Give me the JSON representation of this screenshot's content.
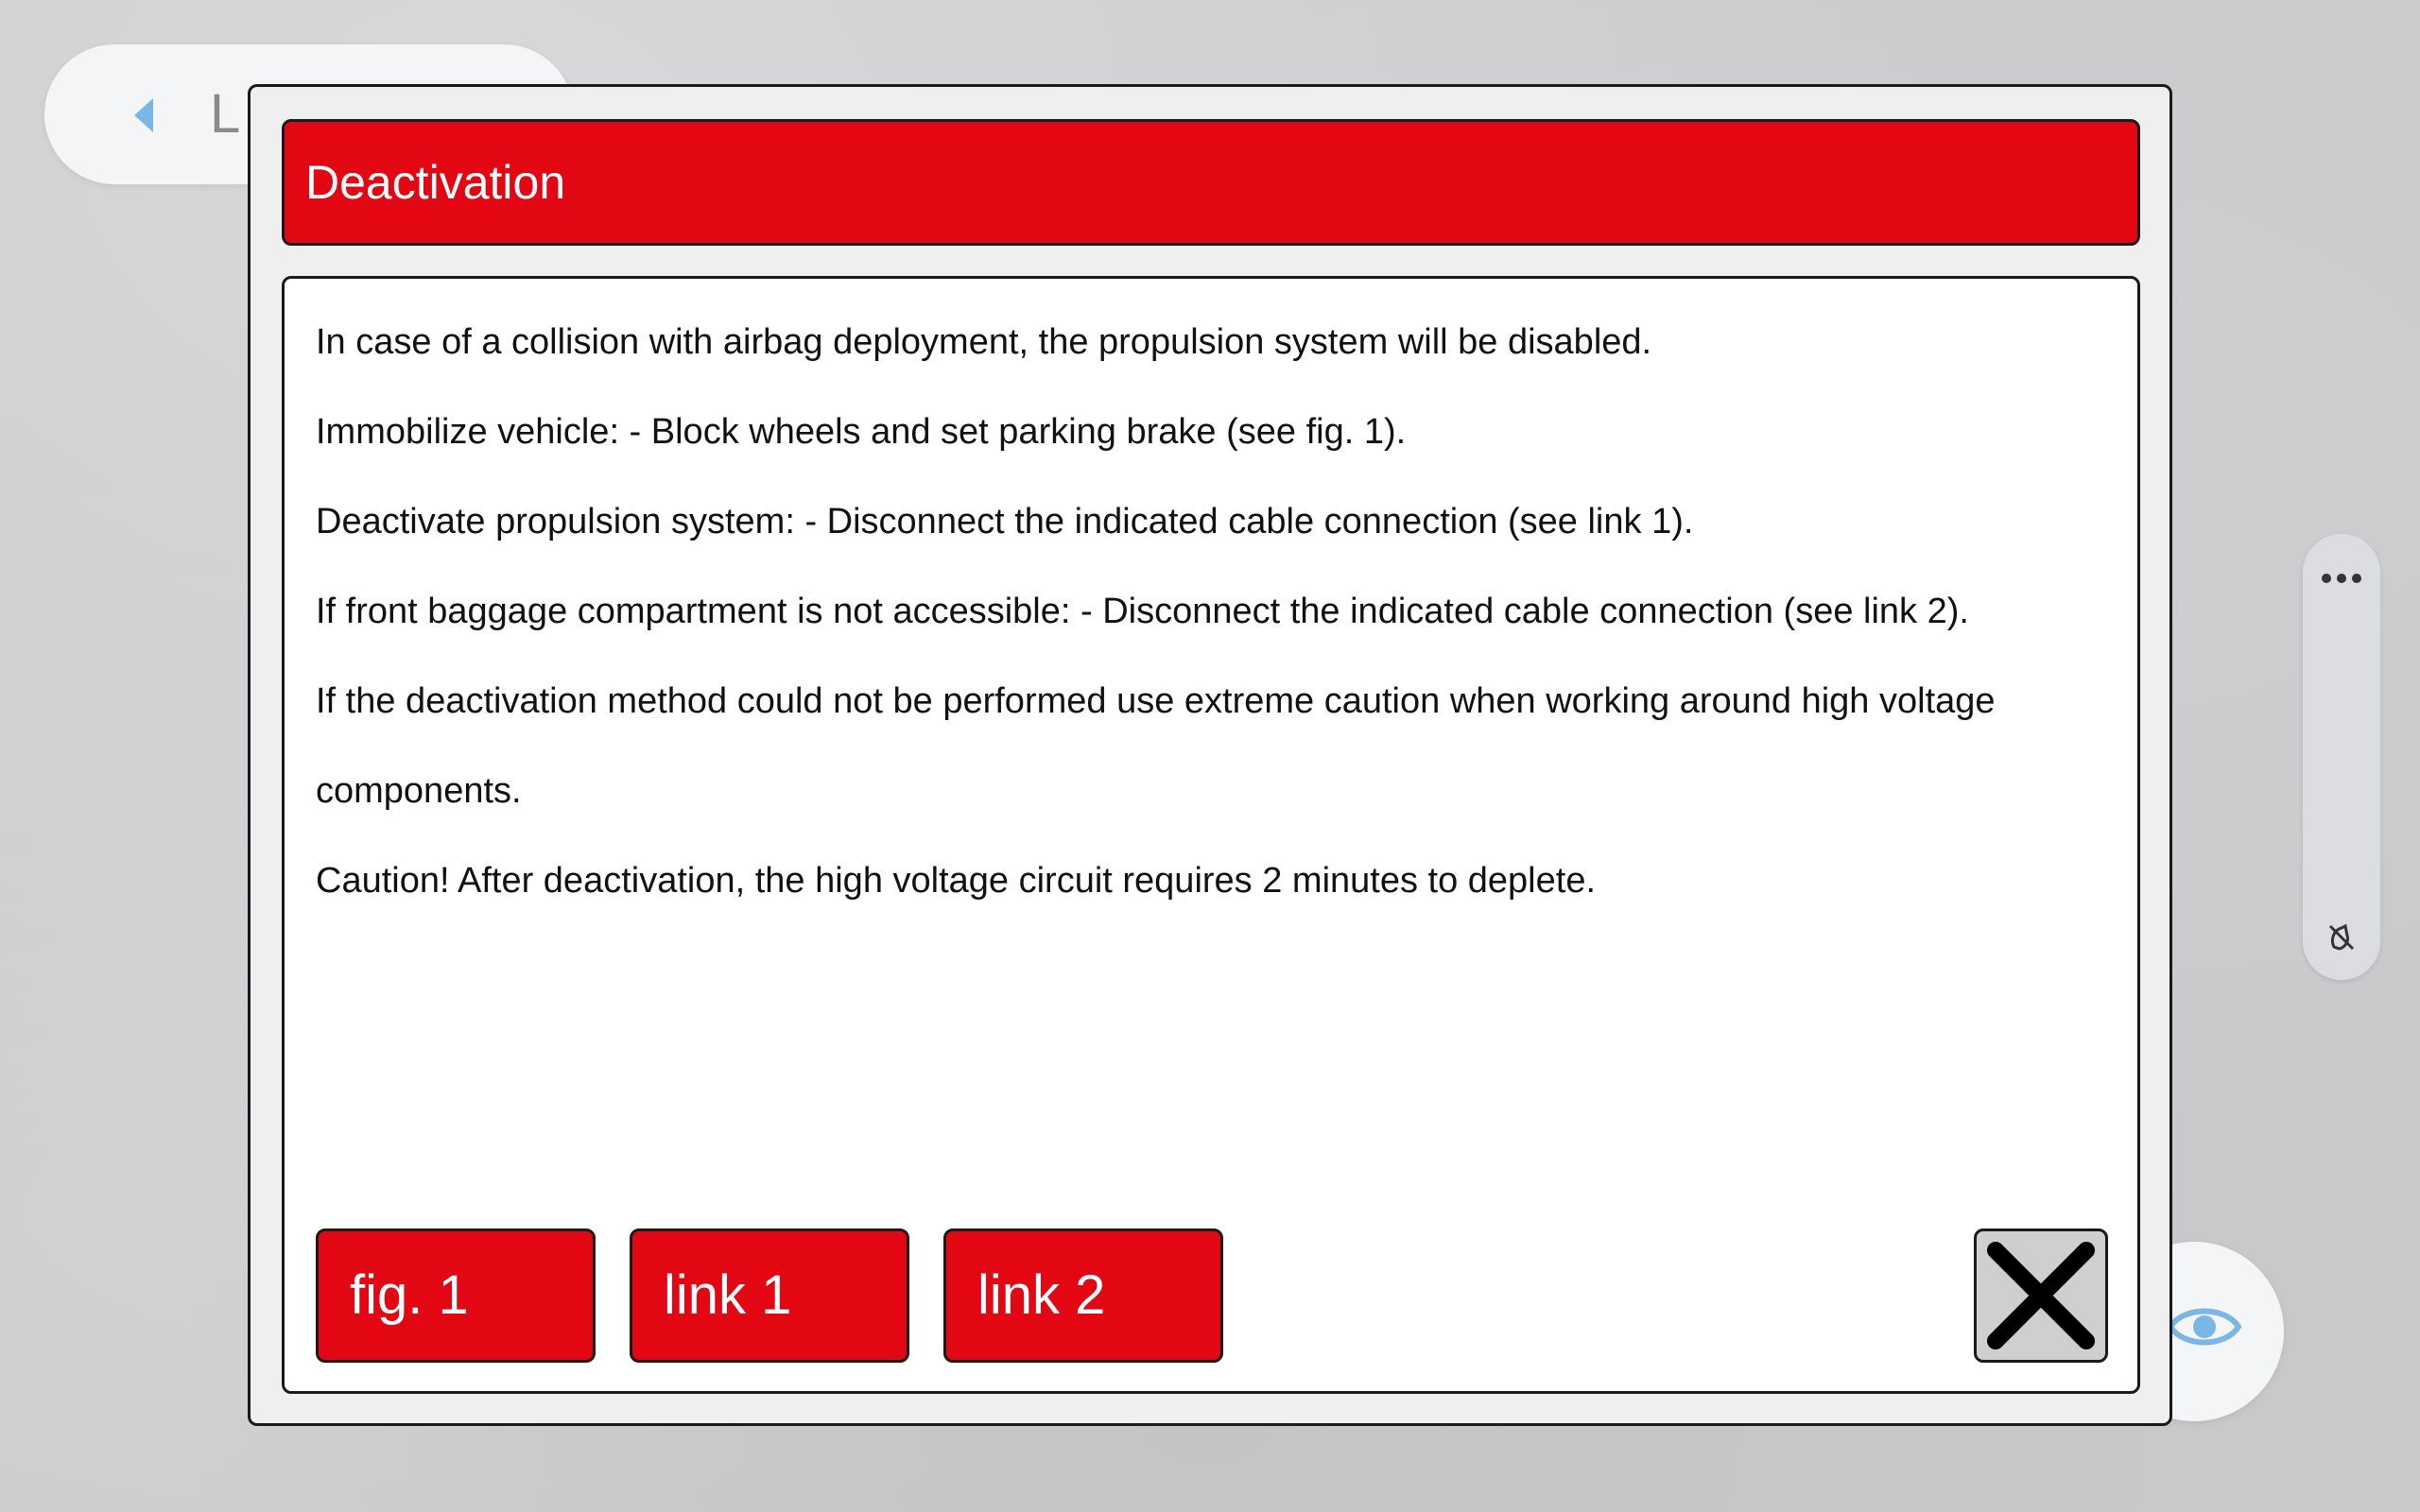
{
  "background": {
    "back_label": "L"
  },
  "dialog": {
    "title": "Deactivation",
    "paragraphs": [
      "In case of a collision with airbag deployment, the propulsion system will be disabled.",
      "Immobilize vehicle: - Block wheels and set parking brake (see fig. 1).",
      "Deactivate propulsion system: - Disconnect the indicated cable connection (see link 1).",
      "If front baggage compartment is not accessible: - Disconnect the indicated cable connection (see link 2).",
      "If the deactivation method could not be performed use extreme caution when working around high voltage components.",
      "Caution! After deactivation, the high voltage circuit requires 2 minutes to deplete."
    ],
    "buttons": [
      {
        "label": "fig. 1"
      },
      {
        "label": "link 1"
      },
      {
        "label": "link 2"
      }
    ]
  },
  "colors": {
    "accent_red": "#e30613",
    "border": "#1a1a1a",
    "eye_blue": "#7ab6e6"
  },
  "icons": {
    "back": "chevron-left-icon",
    "more": "more-horizontal-icon",
    "mute": "mute-icon",
    "eye": "eye-icon",
    "close": "close-icon"
  }
}
